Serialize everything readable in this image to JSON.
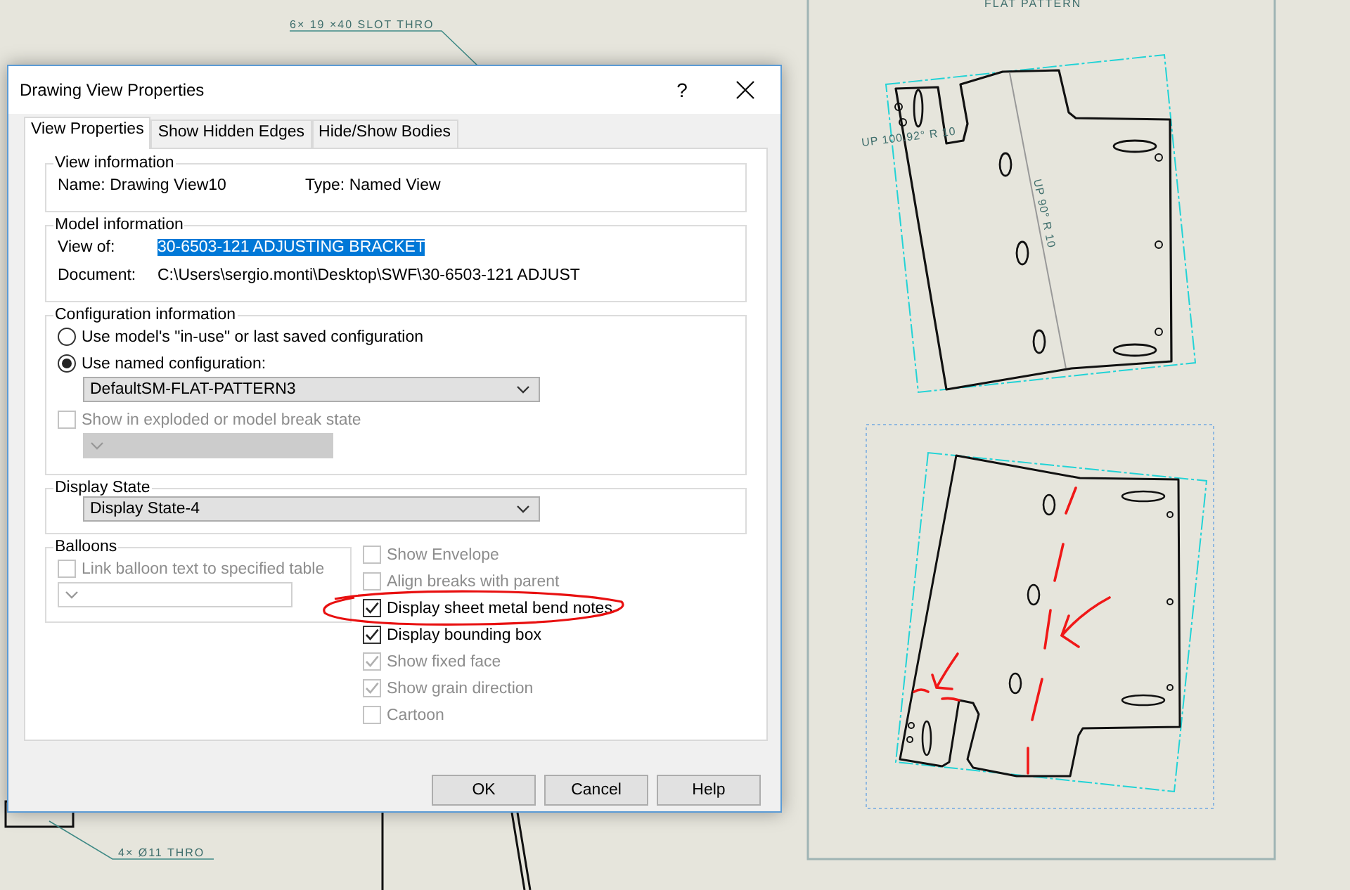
{
  "drawing": {
    "view_label": "FLAT PATTERN",
    "callouts": [
      {
        "text": "6× 19 ×40 SLOT THRO"
      },
      {
        "text": "4× Ø11 THRO"
      }
    ],
    "bend_notes": [
      {
        "text": "UP 100.92° R 10"
      },
      {
        "text": "UP 90° R 10"
      }
    ]
  },
  "dialog": {
    "title": "Drawing View Properties",
    "help": "?",
    "tabs": [
      {
        "label": "View Properties",
        "selected": true
      },
      {
        "label": "Show Hidden Edges",
        "selected": false
      },
      {
        "label": "Hide/Show Bodies",
        "selected": false
      }
    ],
    "view_information": {
      "title": "View information",
      "name": "Name: Drawing View10",
      "type": "Type: Named View"
    },
    "model_information": {
      "title": "Model information",
      "view_of_label": "View of:",
      "view_of_value": "30-6503-121 ADJUSTING BRACKET",
      "view_of_highlighted": true,
      "document_label": "Document:",
      "document_value": "C:\\Users\\sergio.monti\\Desktop\\SWF\\30-6503-121 ADJUST"
    },
    "configuration": {
      "title": "Configuration information",
      "options": [
        {
          "label": "Use model's \"in-use\" or last saved configuration",
          "selected": false
        },
        {
          "label": "Use named configuration:",
          "selected": true
        }
      ],
      "configuration_value": "DefaultSM-FLAT-PATTERN3",
      "exploded": {
        "label": "Show in exploded or model break state",
        "checked": false,
        "disabled": true
      }
    },
    "display_state": {
      "title": "Display State",
      "value": "Display State-4"
    },
    "balloons": {
      "title": "Balloons",
      "link": {
        "label": "Link balloon text to specified table",
        "checked": false,
        "disabled": true
      }
    },
    "options": [
      {
        "label": "Show Envelope",
        "checked": false,
        "disabled": true
      },
      {
        "label": "Align breaks with parent",
        "checked": false,
        "disabled": true
      },
      {
        "label": "Display sheet metal bend notes",
        "checked": true,
        "disabled": false
      },
      {
        "label": "Display bounding box",
        "checked": true,
        "disabled": false
      },
      {
        "label": "Show fixed face",
        "checked": true,
        "disabled": true
      },
      {
        "label": "Show grain direction",
        "checked": true,
        "disabled": true
      },
      {
        "label": "Cartoon",
        "checked": false,
        "disabled": true
      }
    ],
    "buttons": [
      {
        "label": "OK"
      },
      {
        "label": "Cancel"
      },
      {
        "label": "Help"
      }
    ]
  }
}
